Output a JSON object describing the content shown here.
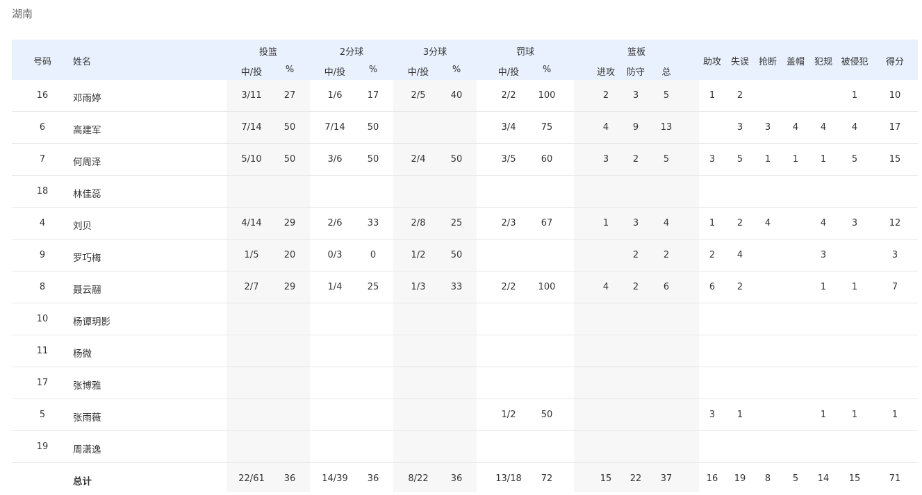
{
  "team": "湖南",
  "header": {
    "number": "号码",
    "name": "姓名",
    "groups": {
      "fg": "投篮",
      "two": "2分球",
      "three": "3分球",
      "ft": "罚球",
      "reb": "篮板"
    },
    "made_att": "中/投",
    "pct": "%",
    "off": "进攻",
    "def": "防守",
    "tot": "总",
    "ast": "助攻",
    "to": "失误",
    "stl": "抢断",
    "blk": "盖帽",
    "pf": "犯规",
    "fd": "被侵犯",
    "pts": "得分"
  },
  "rows": [
    {
      "num": "16",
      "name": "邓雨婷",
      "fg": "3/11",
      "fgp": "27",
      "two": "1/6",
      "twop": "17",
      "three": "2/5",
      "threep": "40",
      "ft": "2/2",
      "ftp": "100",
      "oreb": "2",
      "dreb": "3",
      "reb": "5",
      "ast": "1",
      "to": "2",
      "stl": "",
      "blk": "",
      "pf": "",
      "fd": "1",
      "pts": "10"
    },
    {
      "num": "6",
      "name": "高建军",
      "fg": "7/14",
      "fgp": "50",
      "two": "7/14",
      "twop": "50",
      "three": "",
      "threep": "",
      "ft": "3/4",
      "ftp": "75",
      "oreb": "4",
      "dreb": "9",
      "reb": "13",
      "ast": "",
      "to": "3",
      "stl": "3",
      "blk": "4",
      "pf": "4",
      "fd": "4",
      "pts": "17"
    },
    {
      "num": "7",
      "name": "何周泽",
      "fg": "5/10",
      "fgp": "50",
      "two": "3/6",
      "twop": "50",
      "three": "2/4",
      "threep": "50",
      "ft": "3/5",
      "ftp": "60",
      "oreb": "3",
      "dreb": "2",
      "reb": "5",
      "ast": "3",
      "to": "5",
      "stl": "1",
      "blk": "1",
      "pf": "1",
      "fd": "5",
      "pts": "15"
    },
    {
      "num": "18",
      "name": "林佳蕊",
      "fg": "",
      "fgp": "",
      "two": "",
      "twop": "",
      "three": "",
      "threep": "",
      "ft": "",
      "ftp": "",
      "oreb": "",
      "dreb": "",
      "reb": "",
      "ast": "",
      "to": "",
      "stl": "",
      "blk": "",
      "pf": "",
      "fd": "",
      "pts": ""
    },
    {
      "num": "4",
      "name": "刘贝",
      "fg": "4/14",
      "fgp": "29",
      "two": "2/6",
      "twop": "33",
      "three": "2/8",
      "threep": "25",
      "ft": "2/3",
      "ftp": "67",
      "oreb": "1",
      "dreb": "3",
      "reb": "4",
      "ast": "1",
      "to": "2",
      "stl": "4",
      "blk": "",
      "pf": "4",
      "fd": "3",
      "pts": "12"
    },
    {
      "num": "9",
      "name": "罗巧梅",
      "fg": "1/5",
      "fgp": "20",
      "two": "0/3",
      "twop": "0",
      "three": "1/2",
      "threep": "50",
      "ft": "",
      "ftp": "",
      "oreb": "",
      "dreb": "2",
      "reb": "2",
      "ast": "2",
      "to": "4",
      "stl": "",
      "blk": "",
      "pf": "3",
      "fd": "",
      "pts": "3"
    },
    {
      "num": "8",
      "name": "聂云翮",
      "fg": "2/7",
      "fgp": "29",
      "two": "1/4",
      "twop": "25",
      "three": "1/3",
      "threep": "33",
      "ft": "2/2",
      "ftp": "100",
      "oreb": "4",
      "dreb": "2",
      "reb": "6",
      "ast": "6",
      "to": "2",
      "stl": "",
      "blk": "",
      "pf": "1",
      "fd": "1",
      "pts": "7"
    },
    {
      "num": "10",
      "name": "杨谭玥影",
      "fg": "",
      "fgp": "",
      "two": "",
      "twop": "",
      "three": "",
      "threep": "",
      "ft": "",
      "ftp": "",
      "oreb": "",
      "dreb": "",
      "reb": "",
      "ast": "",
      "to": "",
      "stl": "",
      "blk": "",
      "pf": "",
      "fd": "",
      "pts": ""
    },
    {
      "num": "11",
      "name": "杨微",
      "fg": "",
      "fgp": "",
      "two": "",
      "twop": "",
      "three": "",
      "threep": "",
      "ft": "",
      "ftp": "",
      "oreb": "",
      "dreb": "",
      "reb": "",
      "ast": "",
      "to": "",
      "stl": "",
      "blk": "",
      "pf": "",
      "fd": "",
      "pts": ""
    },
    {
      "num": "17",
      "name": "张博雅",
      "fg": "",
      "fgp": "",
      "two": "",
      "twop": "",
      "three": "",
      "threep": "",
      "ft": "",
      "ftp": "",
      "oreb": "",
      "dreb": "",
      "reb": "",
      "ast": "",
      "to": "",
      "stl": "",
      "blk": "",
      "pf": "",
      "fd": "",
      "pts": ""
    },
    {
      "num": "5",
      "name": "张雨薇",
      "fg": "",
      "fgp": "",
      "two": "",
      "twop": "",
      "three": "",
      "threep": "",
      "ft": "1/2",
      "ftp": "50",
      "oreb": "",
      "dreb": "",
      "reb": "",
      "ast": "3",
      "to": "1",
      "stl": "",
      "blk": "",
      "pf": "1",
      "fd": "1",
      "pts": "1"
    },
    {
      "num": "19",
      "name": "周潇逸",
      "fg": "",
      "fgp": "",
      "two": "",
      "twop": "",
      "three": "",
      "threep": "",
      "ft": "",
      "ftp": "",
      "oreb": "",
      "dreb": "",
      "reb": "",
      "ast": "",
      "to": "",
      "stl": "",
      "blk": "",
      "pf": "",
      "fd": "",
      "pts": ""
    }
  ],
  "total": {
    "label": "总计",
    "fg": "22/61",
    "fgp": "36",
    "two": "14/39",
    "twop": "36",
    "three": "8/22",
    "threep": "36",
    "ft": "13/18",
    "ftp": "72",
    "oreb": "15",
    "dreb": "22",
    "reb": "37",
    "ast": "16",
    "to": "19",
    "stl": "8",
    "blk": "5",
    "pf": "14",
    "fd": "15",
    "pts": "71"
  }
}
